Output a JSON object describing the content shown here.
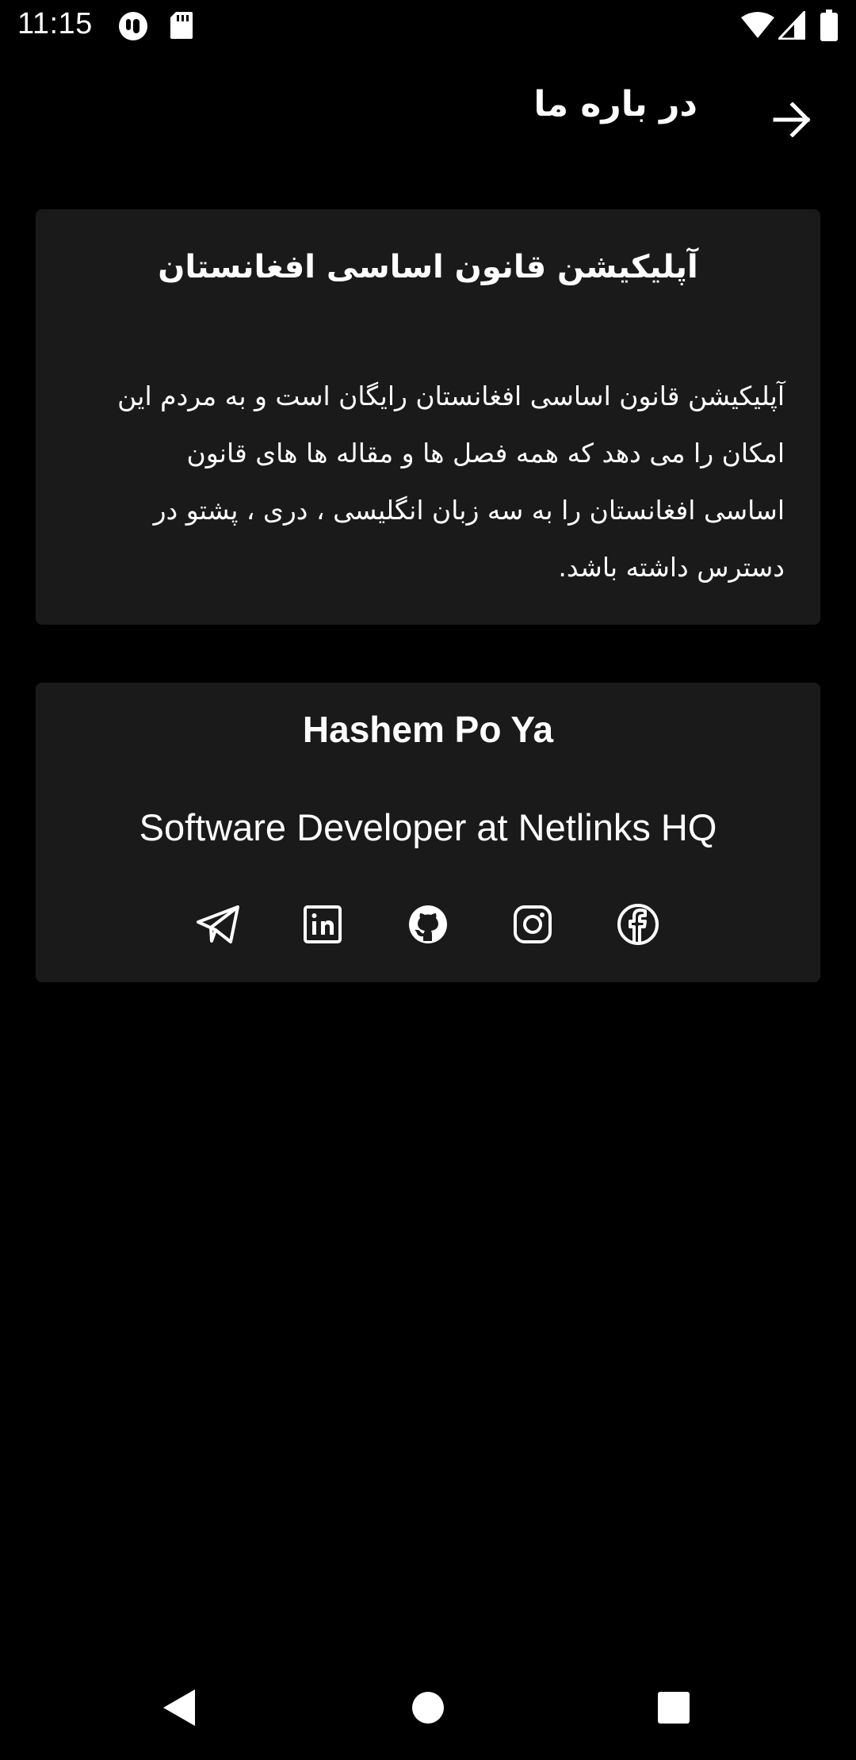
{
  "status_bar": {
    "time": "11:15",
    "icons": [
      "app-notification-icon",
      "sd-card-icon",
      "wifi-icon",
      "signal-icon",
      "battery-icon"
    ]
  },
  "app_bar": {
    "title": "در باره ما",
    "back_icon": "arrow-right-icon"
  },
  "about_card": {
    "title": "آپلیکیشن قانون اساسی افغانستان",
    "body_lines": [
      "آپلیکیشن قانون اساسی افغانستان رایگان است و به مردم این",
      "امکان را می دهد که همه فصل ها و مقاله ها های قانون",
      "اساسی افغانستان را به سه زبان انگلیسی ، دری ، پشتو در",
      "دسترس داشته باشد."
    ]
  },
  "developer_card": {
    "name": "Hashem Po Ya",
    "role": "Software Developer at Netlinks HQ",
    "social_icons": [
      "telegram-icon",
      "linkedin-icon",
      "github-icon",
      "instagram-icon",
      "facebook-icon"
    ]
  },
  "nav_bar": {
    "icons": [
      "back-triangle-icon",
      "home-circle-icon",
      "recents-square-icon"
    ]
  },
  "colors": {
    "background": "#000000",
    "card": "#1a1a1b",
    "text": "#ffffff"
  }
}
